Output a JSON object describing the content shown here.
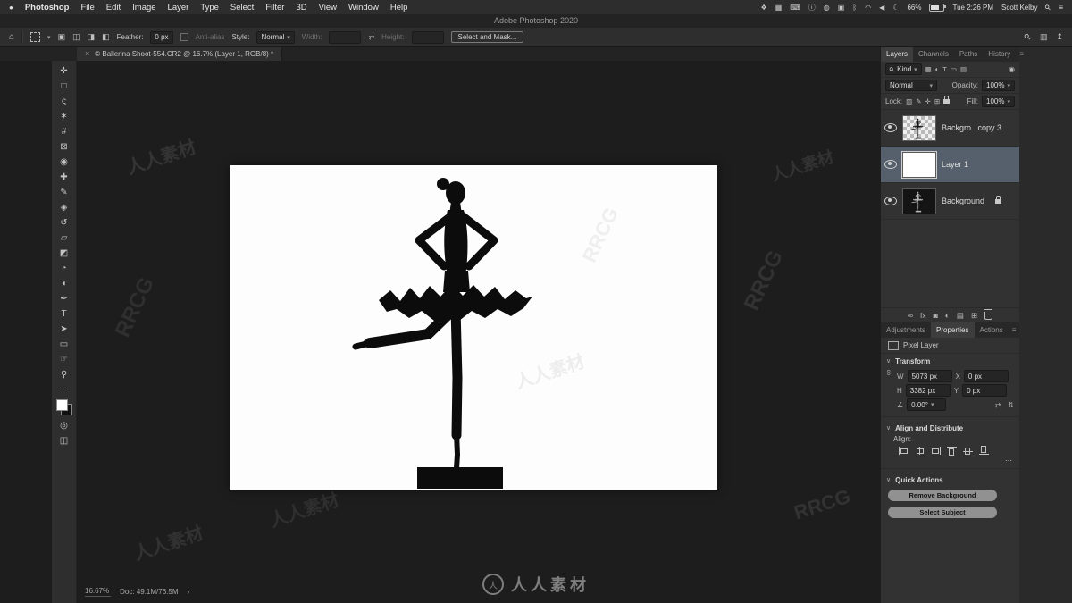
{
  "colors": {
    "selected_layer_highlight": "#56606d",
    "canvas_background": "#fdfdfd",
    "silhouette": "#0c0c0c",
    "ui_background": "#323232",
    "pasteboard": "#1d1d1d",
    "foreground_swatch": "#ffffff",
    "background_swatch": "#101010"
  },
  "watermark": {
    "cn": "人人素材",
    "en": "RRCG",
    "logo_glyph": "人",
    "logo_text": "人人素材"
  },
  "menubar": {
    "apple_glyph": "●",
    "app_name": "Photoshop",
    "items": [
      "File",
      "Edit",
      "Image",
      "Layer",
      "Type",
      "Select",
      "Filter",
      "3D",
      "View",
      "Window",
      "Help"
    ],
    "status_icons": [
      {
        "name": "app-switcher-icon",
        "glyph": "❖"
      },
      {
        "name": "grid-icon",
        "glyph": "▦"
      },
      {
        "name": "keyboard-icon",
        "glyph": "⌨"
      },
      {
        "name": "info-icon",
        "glyph": "ⓘ"
      },
      {
        "name": "droplet-icon",
        "glyph": "◍"
      },
      {
        "name": "display-icon",
        "glyph": "▣"
      },
      {
        "name": "bluetooth-icon",
        "glyph": "ᛒ"
      },
      {
        "name": "wifi-icon",
        "glyph": "◠"
      },
      {
        "name": "volume-icon",
        "glyph": "◀"
      },
      {
        "name": "moon-icon",
        "glyph": "☾"
      }
    ],
    "battery_percent": "66%",
    "time": "Tue 2:26 PM",
    "user": "Scott Kelby",
    "search_glyph": "⚲",
    "list_glyph": "≡"
  },
  "titlebar": {
    "title": "Adobe Photoshop 2020"
  },
  "options_bar": {
    "home_glyph": "⌂",
    "marquee_dropdown_glyph": "▾",
    "combine_icons": [
      {
        "name": "new-selection-icon",
        "glyph": "▣"
      },
      {
        "name": "add-selection-icon",
        "glyph": "◫"
      },
      {
        "name": "subtract-selection-icon",
        "glyph": "◨"
      },
      {
        "name": "intersect-selection-icon",
        "glyph": "◧"
      }
    ],
    "feather_label": "Feather:",
    "feather_value": "0 px",
    "anti_alias_label": "Anti-alias",
    "style_label": "Style:",
    "style_value": "Normal",
    "width_label": "Width:",
    "swap_glyph": "⇄",
    "height_label": "Height:",
    "select_and_mask_label": "Select and Mask...",
    "search_glyph": "⚲",
    "workspace_glyph": "▥",
    "share_glyph": "↥"
  },
  "document_tab": {
    "close_glyph": "×",
    "title": "© Ballerina Shoot-554.CR2 @ 16.7% (Layer 1, RGB/8) *"
  },
  "toolbar": {
    "tools": [
      {
        "name": "move-tool",
        "glyph": "✛"
      },
      {
        "name": "rectangular-marquee-tool",
        "glyph": "□"
      },
      {
        "name": "lasso-tool",
        "glyph": "ϛ"
      },
      {
        "name": "quick-selection-tool",
        "glyph": "✶"
      },
      {
        "name": "crop-tool",
        "glyph": "#"
      },
      {
        "name": "frame-tool",
        "glyph": "⊠"
      },
      {
        "name": "eyedropper-tool",
        "glyph": "◉"
      },
      {
        "name": "spot-healing-brush-tool",
        "glyph": "✚"
      },
      {
        "name": "brush-tool",
        "glyph": "✎"
      },
      {
        "name": "clone-stamp-tool",
        "glyph": "◈"
      },
      {
        "name": "history-brush-tool",
        "glyph": "↺"
      },
      {
        "name": "eraser-tool",
        "glyph": "▱"
      },
      {
        "name": "gradient-tool",
        "glyph": "◩"
      },
      {
        "name": "blur-tool",
        "glyph": "◔"
      },
      {
        "name": "dodge-tool",
        "glyph": "◖"
      },
      {
        "name": "pen-tool",
        "glyph": "✒"
      },
      {
        "name": "type-tool",
        "glyph": "T"
      },
      {
        "name": "path-selection-tool",
        "glyph": "➤"
      },
      {
        "name": "shape-tool",
        "glyph": "▭"
      },
      {
        "name": "hand-tool",
        "glyph": "☞"
      },
      {
        "name": "zoom-tool",
        "glyph": "⚲"
      }
    ],
    "more_glyph": "⋯",
    "quick_mask_glyph": "◎",
    "screen_mode_glyph": "◫"
  },
  "layers_panel": {
    "tabs": [
      "Layers",
      "Channels",
      "Paths",
      "History"
    ],
    "panel_menu_glyph": "≡",
    "search_glyph": "⚲",
    "kind_label": "Kind",
    "kind_dropdown_glyph": "▾",
    "filter_icons": [
      {
        "name": "filter-pixel-icon",
        "glyph": "▦"
      },
      {
        "name": "filter-adjustment-icon",
        "glyph": "◐"
      },
      {
        "name": "filter-type-icon",
        "glyph": "T"
      },
      {
        "name": "filter-shape-icon",
        "glyph": "▭"
      },
      {
        "name": "filter-smart-object-icon",
        "glyph": "▤"
      }
    ],
    "filter_toggle_glyph": "◉",
    "blend_mode": "Normal",
    "dropdown_glyph": "▾",
    "opacity_label": "Opacity:",
    "opacity_value": "100%",
    "lock_label": "Lock:",
    "lock_icons": [
      {
        "name": "lock-transparency-icon",
        "glyph": "▨"
      },
      {
        "name": "lock-paint-icon",
        "glyph": "✎"
      },
      {
        "name": "lock-position-icon",
        "glyph": "✛"
      },
      {
        "name": "lock-artboard-icon",
        "glyph": "⊞"
      }
    ],
    "fill_label": "Fill:",
    "fill_value": "100%",
    "layers": [
      {
        "name": "Backgro...copy 3"
      },
      {
        "name": "Layer 1"
      },
      {
        "name": "Background"
      }
    ],
    "bottom_icons": [
      {
        "name": "link-layers-icon",
        "glyph": "∞"
      },
      {
        "name": "layer-effects-icon",
        "glyph": "fx"
      },
      {
        "name": "layer-mask-icon",
        "glyph": "◙"
      },
      {
        "name": "adjustment-layer-icon",
        "glyph": "◐"
      },
      {
        "name": "layer-group-icon",
        "glyph": "▤"
      },
      {
        "name": "new-layer-icon",
        "glyph": "⊞"
      }
    ]
  },
  "properties_panel": {
    "tabs": [
      "Adjustments",
      "Properties",
      "Actions"
    ],
    "panel_menu_glyph": "≡",
    "layer_type": "Pixel Layer",
    "transform": {
      "title": "Transform",
      "chevron": "∨",
      "link_glyph": "∞",
      "w_label": "W",
      "w_value": "5073 px",
      "x_label": "X",
      "x_value": "0 px",
      "h_label": "H",
      "h_value": "3382 px",
      "y_label": "Y",
      "y_value": "0 px",
      "angle_glyph": "∠",
      "angle_value": "0.00°",
      "angle_dropdown_glyph": "▾",
      "flip_h_glyph": "⇄",
      "flip_v_glyph": "⇅"
    },
    "align": {
      "title": "Align and Distribute",
      "chevron": "∨",
      "align_label": "Align:",
      "more_glyph": "⋯"
    },
    "quick_actions": {
      "title": "Quick Actions",
      "chevron": "∨",
      "remove_background_label": "Remove Background",
      "select_subject_label": "Select Subject"
    }
  },
  "status_bar": {
    "zoom": "16.67%",
    "doc_label": "Doc: 49.1M/76.5M",
    "chevron": "›"
  }
}
